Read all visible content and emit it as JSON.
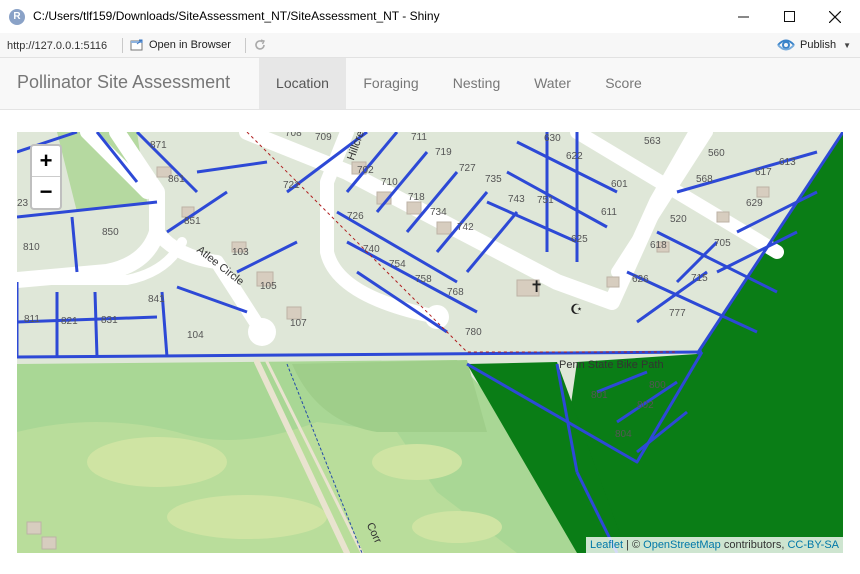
{
  "window": {
    "title": "C:/Users/tlf159/Downloads/SiteAssessment_NT/SiteAssessment_NT - Shiny",
    "icon_letter": "R"
  },
  "toolbar": {
    "url": "http://127.0.0.1:5116",
    "open_in_browser": "Open in Browser",
    "publish": "Publish"
  },
  "navbar": {
    "brand": "Pollinator Site Assessment",
    "tabs": [
      {
        "label": "Location",
        "active": true
      },
      {
        "label": "Foraging",
        "active": false
      },
      {
        "label": "Nesting",
        "active": false
      },
      {
        "label": "Water",
        "active": false
      },
      {
        "label": "Score",
        "active": false
      }
    ]
  },
  "map": {
    "zoom_in": "+",
    "zoom_out": "−",
    "streets": {
      "atlee": "Atlee Circle",
      "hillcrest": "Hillcres",
      "bike_path": "Penn State Bike Path",
      "corr": "Corr"
    },
    "lots": [
      "871",
      "861",
      "851",
      "850",
      "810",
      "103",
      "105",
      "107",
      "104",
      "841",
      "811",
      "821",
      "831",
      "702",
      "710",
      "718",
      "726",
      "734",
      "742",
      "740",
      "754",
      "758",
      "768",
      "780",
      "711",
      "719",
      "727",
      "735",
      "743",
      "751",
      "630",
      "622",
      "601",
      "611",
      "625",
      "563",
      "560",
      "568",
      "617",
      "613",
      "629",
      "520",
      "618",
      "705",
      "626",
      "715",
      "777",
      "801",
      "800",
      "802",
      "804",
      "23",
      "709",
      "721",
      "708"
    ],
    "attribution": {
      "leaflet": "Leaflet",
      "separator": " | © ",
      "osm": "OpenStreetMap",
      "contributors": " contributors, ",
      "license": "CC-BY-SA"
    },
    "colors": {
      "boundary": "#2d49d6",
      "forest_polygon": "#0a7d16",
      "park": "#a8d894",
      "road": "#ffffff"
    }
  }
}
